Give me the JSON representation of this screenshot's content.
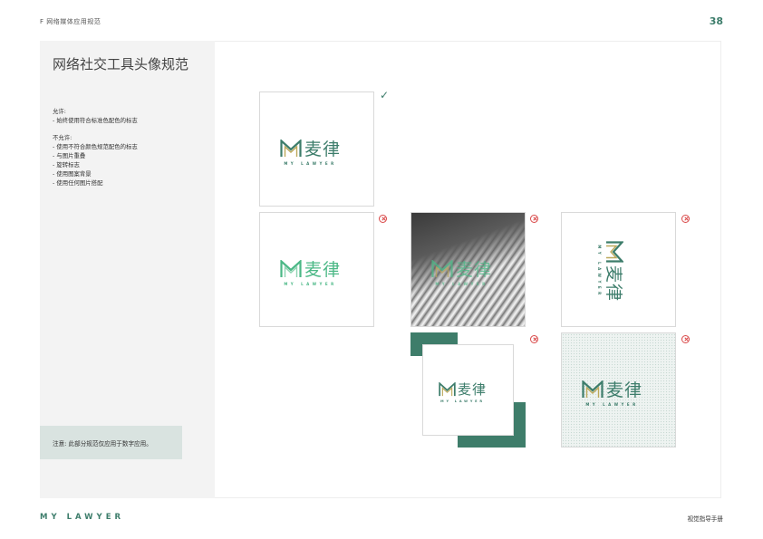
{
  "header": {
    "section": "F   网络媒体应用规范",
    "page_number": "38"
  },
  "sidebar": {
    "title": "网络社交工具头像规范",
    "allowed_heading": "允许:",
    "allowed_items": [
      "- 始终使用符合标准色配色的标志"
    ],
    "disallowed_heading": "不允许:",
    "disallowed_items": [
      "- 使用不符合颜色规范配色的标志",
      "- 与图片重叠",
      "- 旋转标志",
      "- 使用图案背景",
      "- 使用任何图片搭配"
    ],
    "note": "注意: 此部分规范仅应用于数字应用。"
  },
  "logo": {
    "cn": "麦律",
    "en": "MY LAWYER"
  },
  "colors": {
    "brand_green": "#3d7d6b",
    "logo_light_green": "#4bb886",
    "error_red": "#d94848"
  },
  "examples": [
    {
      "status": "allowed",
      "icon": "check-icon",
      "background": "white"
    },
    {
      "status": "disallowed",
      "icon": "error-circle-icon",
      "background": "white",
      "logo_color": "light-green"
    },
    {
      "status": "disallowed",
      "icon": "error-circle-icon",
      "background": "photo",
      "overlap": true
    },
    {
      "status": "disallowed",
      "icon": "error-circle-icon",
      "background": "white",
      "rotated": true
    },
    {
      "status": "disallowed",
      "icon": "error-circle-icon",
      "background": "green-blocks"
    },
    {
      "status": "disallowed",
      "icon": "error-circle-icon",
      "background": "pattern"
    }
  ],
  "footer": {
    "brand": "MY LAWYER",
    "right": "视觉指导手册"
  }
}
